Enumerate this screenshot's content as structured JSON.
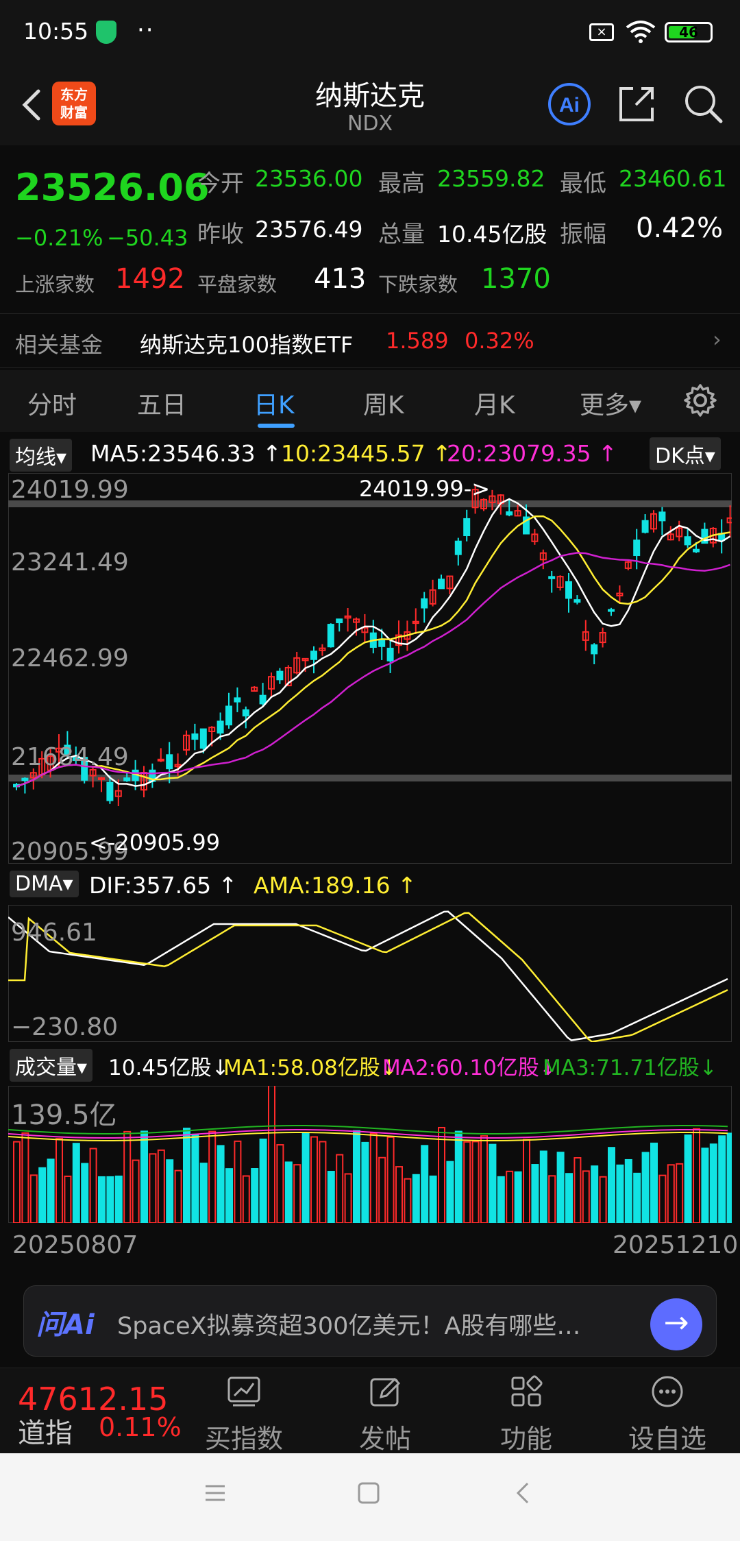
{
  "status_bar": {
    "time": "10:55",
    "dots": "··",
    "battery": "46"
  },
  "header": {
    "title": "纳斯达克",
    "subtitle": "NDX",
    "ai_label": "Ai",
    "logo_line1": "东方",
    "logo_line2": "财富"
  },
  "quote": {
    "last": "23526.06",
    "pct_change": "−0.21%",
    "abs_change": "−50.43",
    "open_label": "今开",
    "open": "23536.00",
    "high_label": "最高",
    "high": "23559.82",
    "low_label": "最低",
    "low": "23460.61",
    "prev_label": "昨收",
    "prev": "23576.49",
    "vol_label": "总量",
    "volume": "10.45亿股",
    "amp_label": "振幅",
    "amplitude": "0.42%",
    "up_label": "上涨家数",
    "up_count": "1492",
    "flat_label": "平盘家数",
    "flat_count": "413",
    "down_label": "下跌家数",
    "down_count": "1370"
  },
  "fund": {
    "label": "相关基金",
    "name": "纳斯达克100指数ETF",
    "price": "1.589",
    "pct": "0.32%",
    "chevron": "›"
  },
  "tabs": [
    {
      "label": "分时"
    },
    {
      "label": "五日"
    },
    {
      "label": "日K"
    },
    {
      "label": "周K"
    },
    {
      "label": "月K"
    },
    {
      "label": "更多▾"
    }
  ],
  "ma_legend": {
    "button": "均线",
    "ma5": "MA5:23546.33 ↑",
    "ma10": "10:23445.57 ↑",
    "ma20": "20:23079.35 ↑",
    "dk": "DK点"
  },
  "kline": {
    "ticks": [
      "24019.99",
      "23241.49",
      "22462.99",
      "21684.49",
      "20905.99"
    ],
    "max_label": "24019.99->",
    "min_label": "<-20905.99"
  },
  "dma_legend": {
    "button": "DMA",
    "dif": "DIF:357.65 ↑",
    "ama": "AMA:189.16 ↑"
  },
  "dma": {
    "top": "946.61",
    "bottom": "−230.80"
  },
  "vol_legend": {
    "button": "成交量",
    "vol": "10.45亿股↓",
    "ma1": "MA1:58.08亿股↓",
    "ma2": "MA2:60.10亿股↓",
    "ma3": "MA3:71.71亿股↓"
  },
  "volume_chart": {
    "top": "139.5亿",
    "start_date": "20250807",
    "end_date": "20251210"
  },
  "ask_ai": {
    "brand": "问Ai",
    "prompt": "SpaceX拟募资超300亿美元！A股有哪些…",
    "go": "→"
  },
  "bottom_nav": {
    "dow_value": "47612.15",
    "dow_label": "道指",
    "dow_pct": "0.11%",
    "items": [
      {
        "label": "买指数"
      },
      {
        "label": "发帖"
      },
      {
        "label": "功能"
      },
      {
        "label": "设自选"
      }
    ]
  },
  "colors": {
    "up": "#ff2a2a",
    "down": "#1fd51f",
    "accent": "#3fa0ff",
    "bear_candle": "#11e3e3",
    "ma5": "#ffffff",
    "ma10": "#ffee33",
    "ma20": "#d020d0"
  }
}
